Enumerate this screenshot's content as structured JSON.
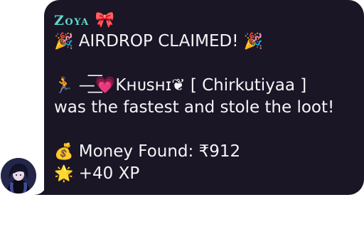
{
  "sender": {
    "name": "Zoya",
    "badge_emoji": "🎀"
  },
  "message": {
    "headline": {
      "emoji_left": "🎉",
      "text": "AIRDROP CLAIMED!",
      "emoji_right": "🎉"
    },
    "winner": {
      "emoji": "🏃",
      "name": "—͟͞💗Kʜᴜsʜɪ❦ [ Chirkutiyaa ]",
      "action": "was the fastest and stole the loot!"
    },
    "money": {
      "emoji": "💰",
      "text": "Money Found: ₹912"
    },
    "xp": {
      "emoji": "🌟",
      "text": "+40 XP"
    }
  },
  "colors": {
    "bubble_bg": "#1a1626",
    "sender_name": "#5fd8c9",
    "text": "#f5f5f7"
  }
}
